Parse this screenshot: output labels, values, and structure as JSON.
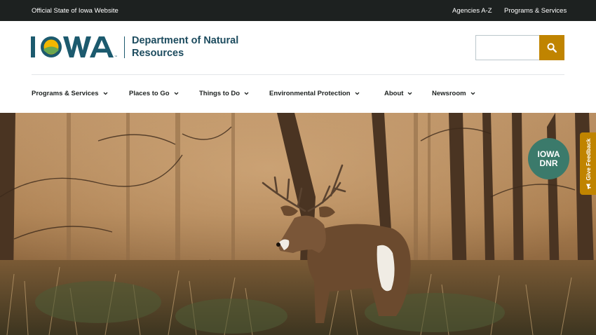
{
  "topbar": {
    "official": "Official State of Iowa Website",
    "links": [
      "Agencies A-Z",
      "Programs & Services"
    ]
  },
  "header": {
    "logo_text": "IOWA",
    "department_line1": "Department of Natural",
    "department_line2": "Resources",
    "search": {
      "placeholder": "",
      "value": "",
      "button_icon": "search-icon"
    }
  },
  "nav": {
    "items": [
      {
        "label": "Programs & Services"
      },
      {
        "label": "Places to Go"
      },
      {
        "label": "Things to Do"
      },
      {
        "label": "Environmental Protection"
      },
      {
        "label": "About"
      },
      {
        "label": "Newsroom"
      }
    ]
  },
  "hero": {
    "image_subject": "white-tailed deer buck in autumn woods",
    "badge_line1": "IOWA",
    "badge_line2": "DNR",
    "feedback_label": "Give Feedback",
    "feedback_icon": "megaphone-icon"
  },
  "colors": {
    "topbar_bg": "#1d2120",
    "brand_teal": "#1c5a6e",
    "accent_gold": "#c08400",
    "badge_green": "#3b7a6b"
  }
}
